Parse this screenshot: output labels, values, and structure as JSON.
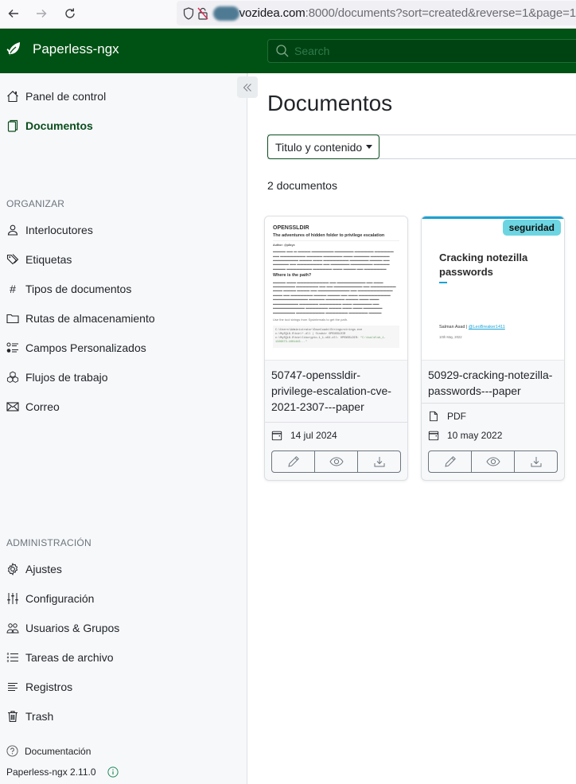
{
  "browser": {
    "url_host": "vozidea.com",
    "url_rest": ":8000/documents?sort=created&reverse=1&page=1",
    "back_icon": "arrow-left-icon",
    "forward_icon": "arrow-right-icon",
    "reload_icon": "reload-icon"
  },
  "app": {
    "name": "Paperless-ngx",
    "search_placeholder": "Search",
    "primary_color": "#005214"
  },
  "sidebar": {
    "main_items": [
      {
        "label": "Panel de control",
        "icon": "home-icon"
      },
      {
        "label": "Documentos",
        "icon": "documents-icon",
        "active": true
      }
    ],
    "organize_header": "ORGANIZAR",
    "organize_items": [
      {
        "label": "Interlocutores",
        "icon": "person-icon"
      },
      {
        "label": "Etiquetas",
        "icon": "tags-icon"
      },
      {
        "label": "Tipos de documentos",
        "icon": "hash-icon"
      },
      {
        "label": "Rutas de almacenamiento",
        "icon": "folder-icon"
      },
      {
        "label": "Campos Personalizados",
        "icon": "ui-radios-icon"
      },
      {
        "label": "Flujos de trabajo",
        "icon": "boxes-icon"
      },
      {
        "label": "Correo",
        "icon": "envelope-icon"
      }
    ],
    "admin_header": "ADMINISTRACIÓN",
    "admin_items": [
      {
        "label": "Ajustes",
        "icon": "gear-icon"
      },
      {
        "label": "Configuración",
        "icon": "sliders-icon"
      },
      {
        "label": "Usuarios & Grupos",
        "icon": "people-icon"
      },
      {
        "label": "Tareas de archivo",
        "icon": "list-task-icon"
      },
      {
        "label": "Registros",
        "icon": "text-left-icon"
      },
      {
        "label": "Trash",
        "icon": "trash-icon"
      }
    ],
    "docs_link": "Documentación",
    "version": "Paperless-ngx 2.11.0",
    "collapse_icon": "chevron-double-left-icon"
  },
  "main": {
    "title": "Documentos",
    "filter_select": "Titulo y contenido",
    "doc_count": "2 documentos",
    "documents": [
      {
        "title": "50747-openssldir-privilege-escalation-cve-2021-2307---paper",
        "date": "14 jul 2024",
        "thumbnail": {
          "heading": "OPENSSLDIR",
          "subheading": "The adventures of hidden folder to privilege escalation",
          "author": "Author: @p8xyx",
          "section": "Where is the path?",
          "tool_line": "Use the tool strings from Sysinternals to get the path."
        }
      },
      {
        "title": "50929-cracking-notezilla-passwords---paper",
        "file_type": "PDF",
        "date": "10 may 2022",
        "tag": "seguridad",
        "tag_color": "#6dd5e1",
        "thumbnail": {
          "title": "Cracking notezilla passwords",
          "author": "Salman Asad | ",
          "author_handle": "@LeoBreaker1411",
          "date": "10th May, 2022"
        }
      }
    ],
    "actions": {
      "edit_icon": "pencil-icon",
      "preview_icon": "eye-icon",
      "download_icon": "download-icon"
    }
  }
}
